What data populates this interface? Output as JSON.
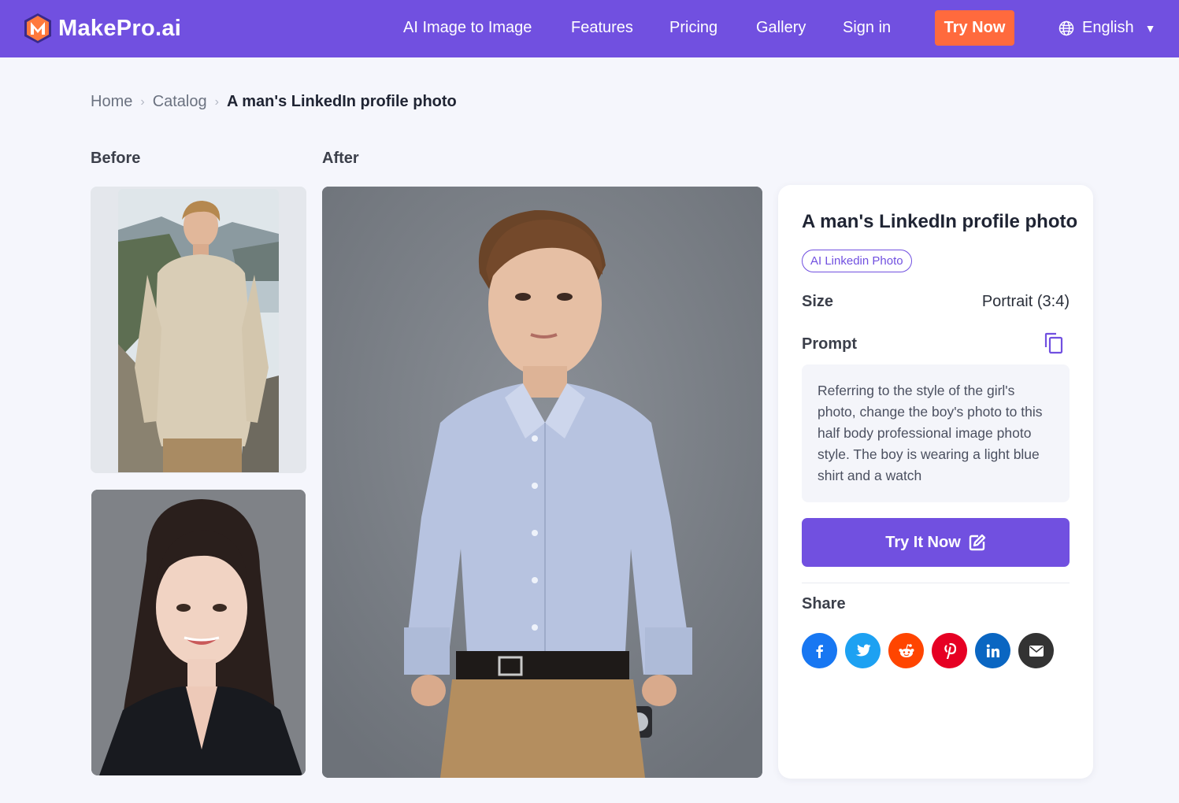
{
  "header": {
    "logo_text": "MakePro.ai",
    "nav": [
      "AI Image to Image",
      "Features",
      "Pricing",
      "Gallery",
      "Sign in"
    ],
    "cta_label": "Try Now",
    "language": "English",
    "colors": {
      "bar": "#7150e0",
      "cta": "#ff6a3d"
    }
  },
  "breadcrumb": {
    "items": [
      "Home",
      "Catalog"
    ],
    "current": "A man's LinkedIn profile photo"
  },
  "gallery": {
    "before_label": "Before",
    "after_label": "After"
  },
  "detail": {
    "title": "A man's LinkedIn profile photo",
    "tag": "AI Linkedin Photo",
    "size_label": "Size",
    "size_value": "Portrait (3:4)",
    "prompt_label": "Prompt",
    "prompt_text": "Referring to the style of the girl's photo, change the boy's photo to this half body professional image photo style. The boy is wearing a light blue shirt and a watch",
    "try_button": "Try It Now",
    "share_label": "Share",
    "share": [
      {
        "name": "facebook",
        "icon": "facebook-icon",
        "color": "#1877f2",
        "glyph": "f"
      },
      {
        "name": "twitter",
        "icon": "twitter-icon",
        "color": "#1da1f2",
        "glyph": "t"
      },
      {
        "name": "reddit",
        "icon": "reddit-icon",
        "color": "#ff4500",
        "glyph": "r"
      },
      {
        "name": "pinterest",
        "icon": "pinterest-icon",
        "color": "#e60023",
        "glyph": "p"
      },
      {
        "name": "linkedin",
        "icon": "linkedin-icon",
        "color": "#0a66c2",
        "glyph": "in"
      },
      {
        "name": "email",
        "icon": "email-icon",
        "color": "#333333",
        "glyph": ""
      }
    ]
  }
}
